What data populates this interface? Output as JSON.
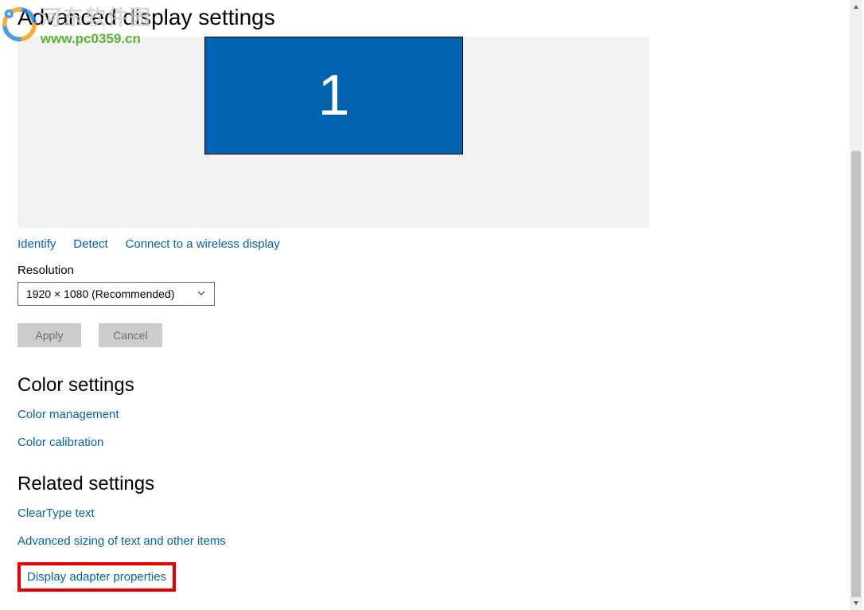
{
  "title": "Advanced display settings",
  "monitor_number": "1",
  "links_top": {
    "identify": "Identify",
    "detect": "Detect",
    "connect_wireless": "Connect to a wireless display"
  },
  "resolution_label": "Resolution",
  "resolution_value": "1920 × 1080 (Recommended)",
  "apply_label": "Apply",
  "cancel_label": "Cancel",
  "color_settings_header": "Color settings",
  "color_links": {
    "color_management": "Color management",
    "color_calibration": "Color calibration"
  },
  "related_settings_header": "Related settings",
  "related_links": {
    "cleartype": "ClearType text",
    "adv_sizing": "Advanced sizing of text and other items",
    "display_adapter": "Display adapter properties"
  },
  "watermark": {
    "text": "河东软件园",
    "url": "www.pc0359.cn"
  }
}
